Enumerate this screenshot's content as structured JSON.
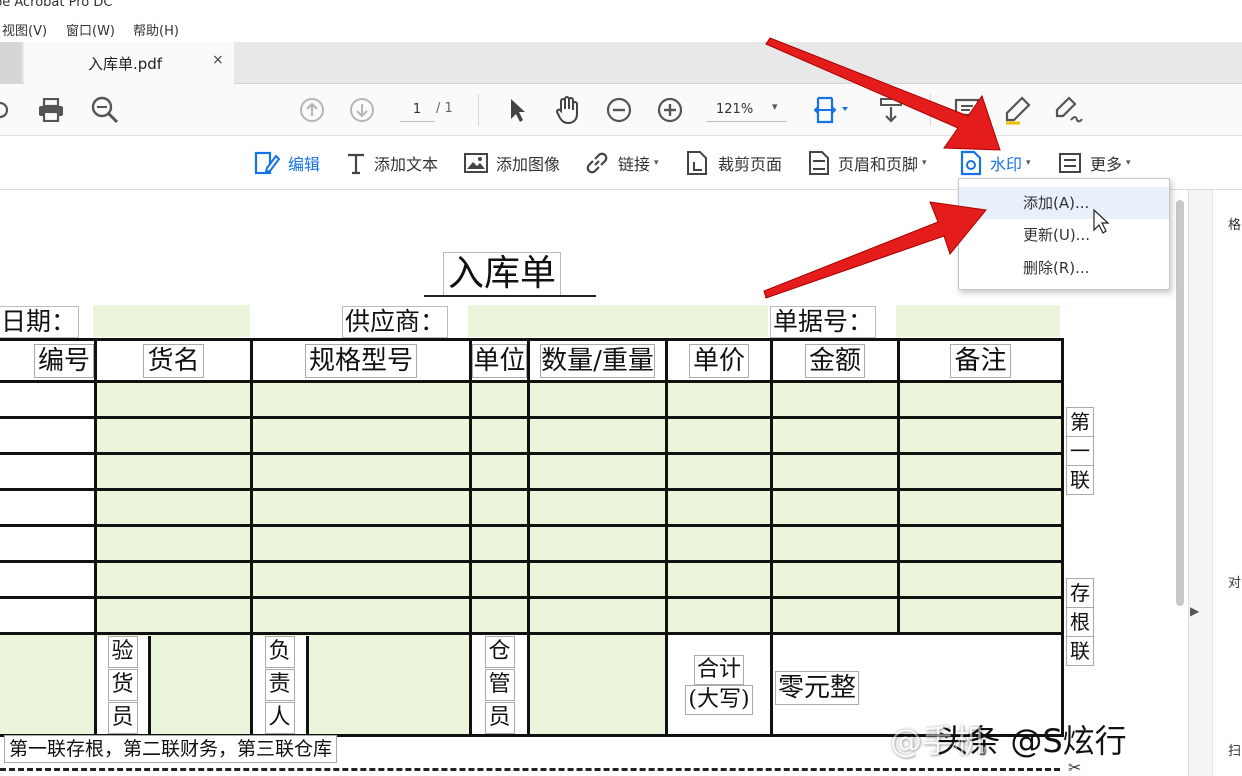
{
  "app": {
    "title": "obe Acrobat Pro DC"
  },
  "menu": {
    "items": [
      "视图(V)",
      "窗口(W)",
      "帮助(H)"
    ]
  },
  "tab": {
    "label": "入库单.pdf",
    "close": "×"
  },
  "toolbar": {
    "page_current": "1",
    "page_total": "/ 1",
    "zoom": "121%",
    "zoom_caret": "▾",
    "icons": [
      "print-icon",
      "search-icon",
      "page-up-icon",
      "page-down-icon",
      "select-cursor-icon",
      "hand-tool-icon",
      "zoom-out-icon",
      "zoom-in-icon",
      "fit-page-icon",
      "scroll-mode-icon",
      "comment-icon",
      "highlight-pen-icon",
      "sign-icon"
    ]
  },
  "edit_toolbar": {
    "edit": "编辑",
    "add_text": "添加文本",
    "add_image": "添加图像",
    "link": "链接",
    "crop": "裁剪页面",
    "header_footer": "页眉和页脚",
    "watermark": "水印",
    "more": "更多",
    "caret": "▾"
  },
  "watermark_menu": {
    "items": [
      "添加(A)...",
      "更新(U)...",
      "删除(R)..."
    ],
    "highlighted_index": 0
  },
  "form": {
    "title": "入库单",
    "date_label": "日期：",
    "supplier_label": "供应商：",
    "doc_no_label": "单据号：",
    "columns": [
      "编号",
      "货名",
      "规格型号",
      "单位",
      "数量/重量",
      "单价",
      "金额",
      "备注"
    ],
    "sign_inspector": [
      "验",
      "货",
      "员"
    ],
    "sign_manager": [
      "负",
      "责",
      "人"
    ],
    "sign_warehouse": [
      "仓",
      "管",
      "员"
    ],
    "total_label_1": "合计",
    "total_label_2": "(大写)",
    "total_value": "零元整",
    "side_first": [
      "第",
      "一",
      "联"
    ],
    "side_stub": [
      "存",
      "根",
      "联"
    ],
    "footnote": "第一联存根，第二联财务，第三联仓库"
  },
  "right_panel": {
    "label_top": "格",
    "label_mid": "对",
    "label_bot": "扫"
  },
  "watermark_text": "头条 @S炫行",
  "watermark_prefix": "@手机",
  "colors": {
    "accent": "#1473e6",
    "form_green": "#eaf5dc",
    "arrow_red": "#e41c1c"
  }
}
